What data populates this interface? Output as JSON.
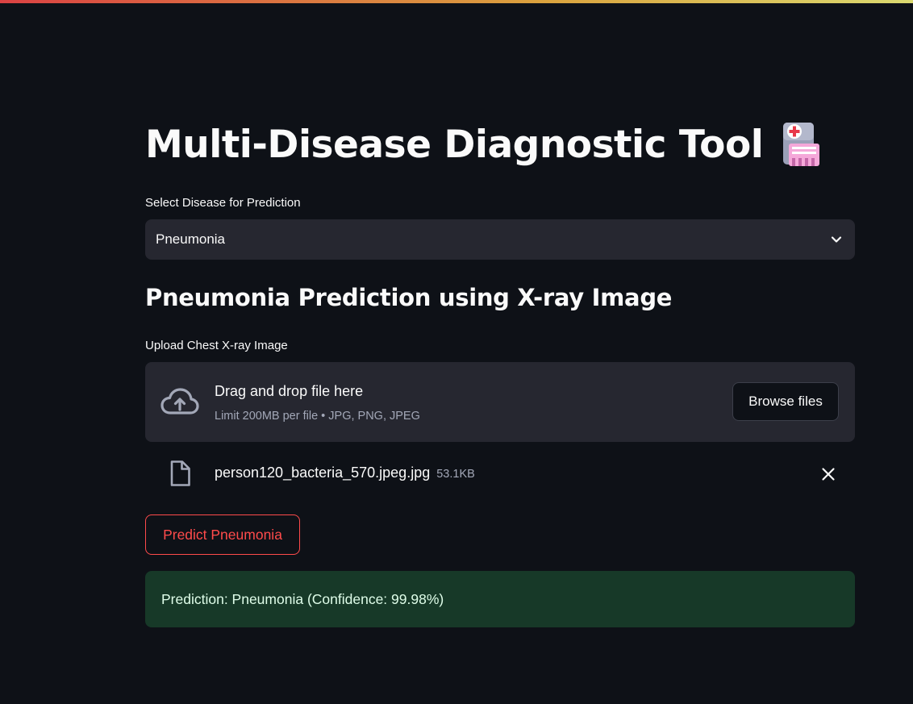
{
  "colors": {
    "background": "#0e1117",
    "widget_bg": "#262730",
    "primary": "#ff4b4b",
    "success_bg": "#173928",
    "success_text": "#dffde9",
    "muted_text": "#a3a8b8"
  },
  "header": {
    "title": "Multi-Disease Diagnostic Tool",
    "title_icon": "hospital-icon"
  },
  "disease_select": {
    "label": "Select Disease for Prediction",
    "value": "Pneumonia",
    "icon": "chevron-down-icon"
  },
  "section": {
    "subheader": "Pneumonia Prediction using X-ray Image"
  },
  "uploader": {
    "label": "Upload Chest X-ray Image",
    "dropzone_title": "Drag and drop file here",
    "dropzone_limit": "Limit 200MB per file • JPG, PNG, JPEG",
    "browse_label": "Browse files",
    "icon": "cloud-upload-icon"
  },
  "uploaded_file": {
    "name": "person120_bacteria_570.jpeg.jpg",
    "size": "53.1KB",
    "icon": "file-icon",
    "remove_icon": "close-icon"
  },
  "predict_button": {
    "label": "Predict Pneumonia"
  },
  "result": {
    "text": "Prediction: Pneumonia (Confidence: 99.98%)"
  }
}
